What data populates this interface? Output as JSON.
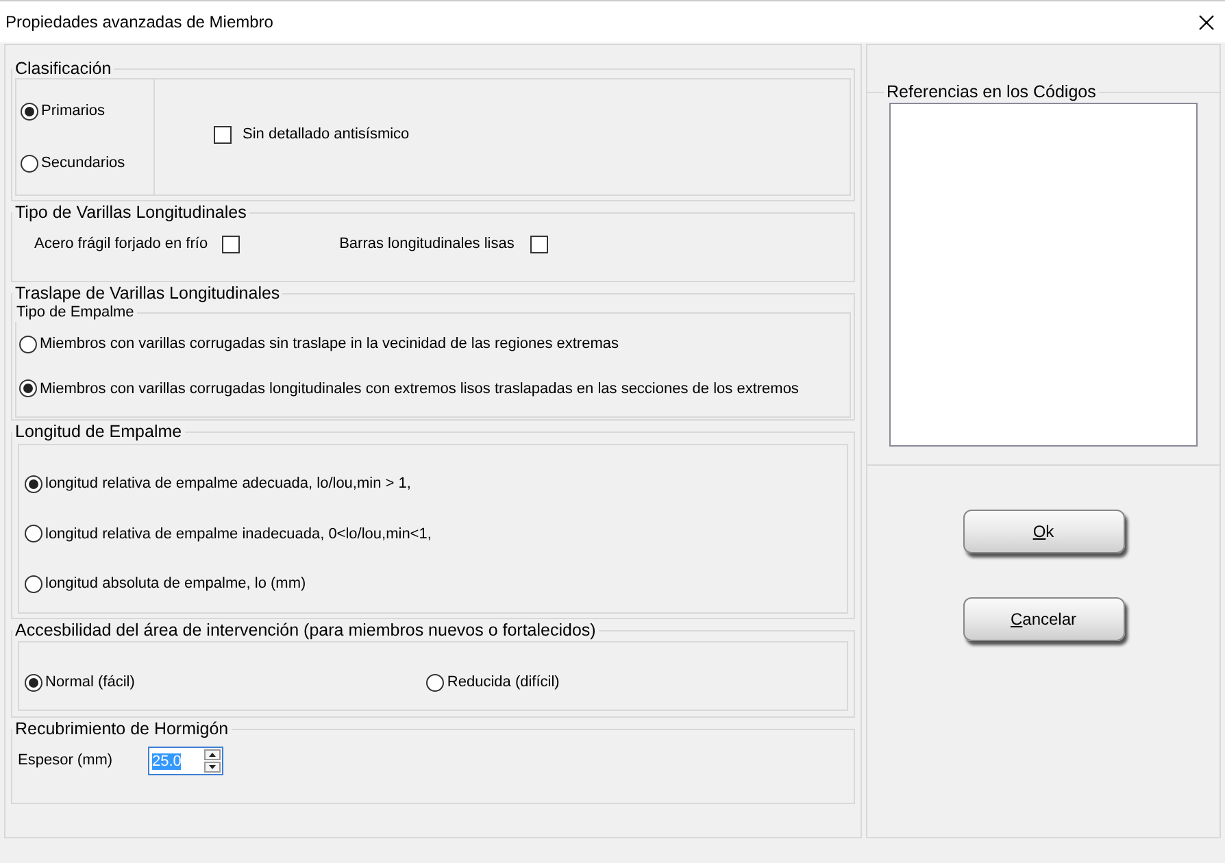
{
  "window": {
    "title": "Propiedades avanzadas de Miembro"
  },
  "clasificacion": {
    "title": "Clasificación",
    "options": [
      {
        "label": "Primarios",
        "selected": true
      },
      {
        "label": "Secundarios",
        "selected": false
      }
    ],
    "checkbox": {
      "label": "Sin detallado antisísmico",
      "checked": false
    }
  },
  "tipo_varillas": {
    "title": "Tipo de Varillas Longitudinales",
    "checkboxes": [
      {
        "label": "Acero frágil forjado en frío",
        "checked": false
      },
      {
        "label": "Barras longitudinales lisas",
        "checked": false
      }
    ]
  },
  "traslape": {
    "title": "Traslape de Varillas Longitudinales",
    "subgroup": {
      "title": "Tipo de Empalme",
      "options": [
        {
          "label": "Miembros con varillas corrugadas sin traslape in la vecinidad de las regiones extremas",
          "selected": false
        },
        {
          "label": "Miembros con varillas corrugadas longitudinales con extremos lisos traslapadas en las secciones de los extremos",
          "selected": true
        }
      ]
    }
  },
  "longitud_empalme": {
    "title": "Longitud de Empalme",
    "options": [
      {
        "label": "longitud relativa de empalme adecuada,  lo/lou,min > 1,",
        "selected": true
      },
      {
        "label": "longitud relativa de empalme inadecuada,  0<lo/lou,min<1,",
        "selected": false
      },
      {
        "label": "longitud absoluta de empalme, lo (mm)",
        "selected": false
      }
    ]
  },
  "accesibilidad": {
    "title": "Accesbilidad del área de intervención (para miembros nuevos o fortalecidos)",
    "options": [
      {
        "label": "Normal (fácil)",
        "selected": true
      },
      {
        "label": "Reducida (difícil)",
        "selected": false
      }
    ]
  },
  "recubrimiento": {
    "title": "Recubrimiento de Hormigón",
    "field": {
      "label": "Espesor (mm)",
      "value": "25.0",
      "text_selected": true
    }
  },
  "referencias": {
    "title": "Referencias en los Códigos"
  },
  "buttons": [
    {
      "label": "Ok"
    },
    {
      "label": "Cancelar"
    }
  ]
}
